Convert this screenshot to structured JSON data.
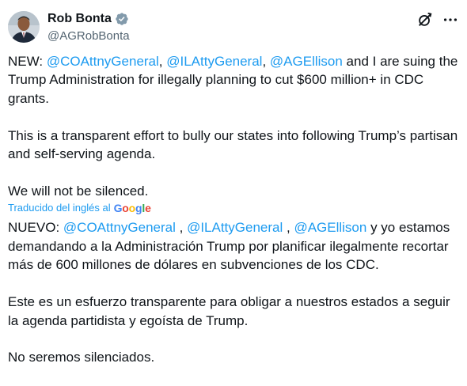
{
  "author": {
    "display_name": "Rob Bonta",
    "handle": "@AGRobBonta"
  },
  "icons": {
    "verified": "verified-badge-icon",
    "grok": "grok-icon",
    "more": "more-icon",
    "avatar": "avatar-photo"
  },
  "colors": {
    "link": "#1d9bf0",
    "text": "#0f1419",
    "secondary": "#536471"
  },
  "original": {
    "p1_prefix": "NEW: ",
    "m1": "@COAttnyGeneral",
    "sep1": ", ",
    "m2": "@ILAttyGeneral",
    "sep2": ", ",
    "m3": "@AGEllison",
    "p1_rest": " and I are suing the Trump Administration for illegally planning to cut $600 million+ in CDC grants.",
    "p2": "This is a transparent effort to bully our states into following Trump’s partisan and self-serving agenda.",
    "p3": "We will not be silenced."
  },
  "translation_label": "Traducido del inglés al",
  "translation_provider": "Google",
  "translated": {
    "p1_prefix": "NUEVO: ",
    "m1": "@COAttnyGeneral",
    "sep1": " , ",
    "m2": "@ILAttyGeneral",
    "sep2": " , ",
    "m3": "@AGEllison",
    "p1_rest": " y yo estamos demandando a la Administración Trump por planificar ilegalmente recortar más de 600 millones de dólares en subvenciones de los CDC.",
    "p2": "Este es un esfuerzo transparente para obligar a nuestros estados a seguir la agenda partidista y egoísta de Trump.",
    "p3": "No seremos silenciados."
  }
}
